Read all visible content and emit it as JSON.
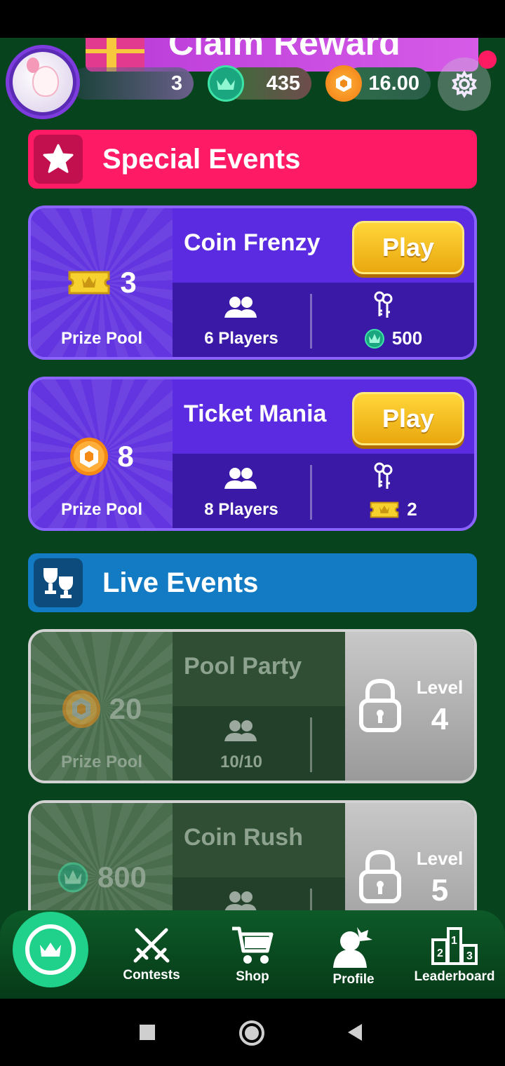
{
  "header": {
    "banner_text": "Claim Reward",
    "level": "3",
    "crowns": "435",
    "coins": "16.00"
  },
  "sections": {
    "special": "Special Events",
    "live": "Live Events"
  },
  "special_events": [
    {
      "title": "Coin Frenzy",
      "play_label": "Play",
      "prize": "3",
      "prize_icon": "ticket-icon",
      "prize_label": "Prize Pool",
      "players": "6 Players",
      "entry": "500",
      "entry_icon": "crown-coin-icon"
    },
    {
      "title": "Ticket Mania",
      "play_label": "Play",
      "prize": "8",
      "prize_icon": "coin-icon",
      "prize_label": "Prize Pool",
      "players": "8 Players",
      "entry": "2",
      "entry_icon": "ticket-icon"
    }
  ],
  "live_events": [
    {
      "title": "Pool Party",
      "prize": "20",
      "prize_icon": "coin-icon",
      "prize_label": "Prize Pool",
      "players": "10/10",
      "level_label": "Level",
      "level": "4"
    },
    {
      "title": "Coin Rush",
      "prize": "800",
      "prize_icon": "crown-coin-icon",
      "level_label": "Level",
      "level": "5"
    }
  ],
  "nav": {
    "contests": "Contests",
    "shop": "Shop",
    "profile": "Profile",
    "leaderboard": "Leaderboard"
  },
  "colors": {
    "background": "#07431c",
    "special_header": "#ff1a66",
    "live_header": "#137bc3",
    "card_purple": "#5a2be0",
    "play_yellow": "#ffd63a"
  }
}
